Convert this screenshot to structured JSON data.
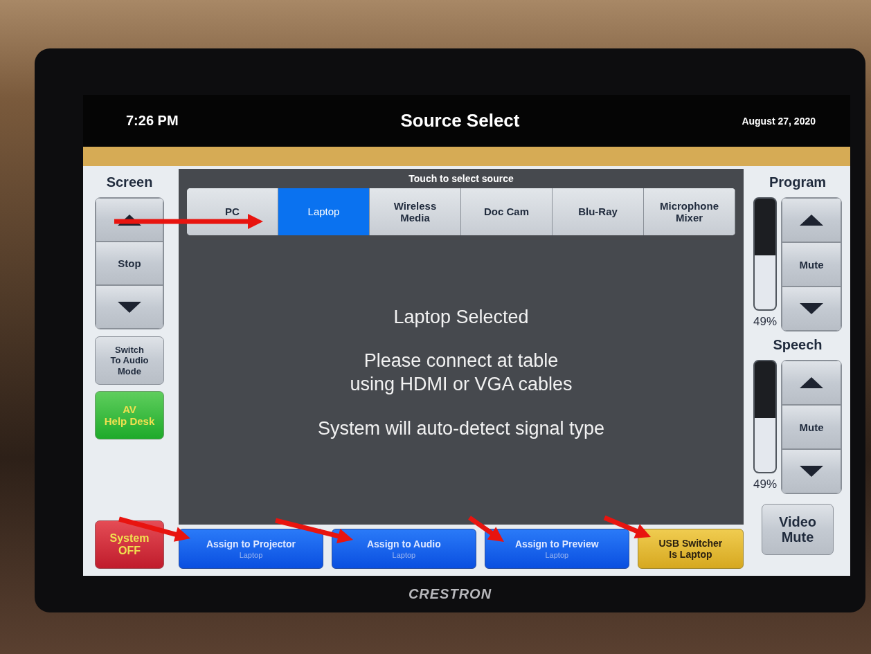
{
  "device": {
    "brand": "CRESTRON"
  },
  "header": {
    "time": "7:26 PM",
    "title": "Source Select",
    "date": "August 27, 2020"
  },
  "screen_control": {
    "title": "Screen",
    "buttons": [
      {
        "kind": "up"
      },
      {
        "kind": "text",
        "label": "Stop"
      },
      {
        "kind": "down"
      }
    ]
  },
  "mode_button": {
    "label": "Switch\nTo Audio\nMode"
  },
  "help_button": {
    "label": "AV\nHelp Desk"
  },
  "power_button": {
    "label": "System\nOFF"
  },
  "source_panel": {
    "title": "Touch to select source",
    "sources": [
      {
        "label": "PC",
        "selected": false
      },
      {
        "label": "Laptop",
        "selected": true
      },
      {
        "label": "Wireless\nMedia",
        "selected": false
      },
      {
        "label": "Doc Cam",
        "selected": false
      },
      {
        "label": "Blu-Ray",
        "selected": false
      },
      {
        "label": "Microphone\nMixer",
        "selected": false
      }
    ],
    "messages": [
      "Laptop Selected",
      "Please connect at table\nusing HDMI or VGA cables",
      "System will auto-detect signal type"
    ]
  },
  "assign_buttons": [
    {
      "label": "Assign to Projector",
      "sublabel": "Laptop"
    },
    {
      "label": "Assign to Audio",
      "sublabel": "Laptop"
    },
    {
      "label": "Assign to Preview",
      "sublabel": "Laptop"
    }
  ],
  "usb_status": {
    "label": "USB Switcher\nIs Laptop"
  },
  "volumes": [
    {
      "name": "Program",
      "level": 0.49,
      "reading": "49%",
      "mute_label": "Mute"
    },
    {
      "name": "Speech",
      "level": 0.49,
      "reading": "49%",
      "mute_label": "Mute"
    }
  ],
  "video_mute": {
    "label": "Video\nMute"
  }
}
